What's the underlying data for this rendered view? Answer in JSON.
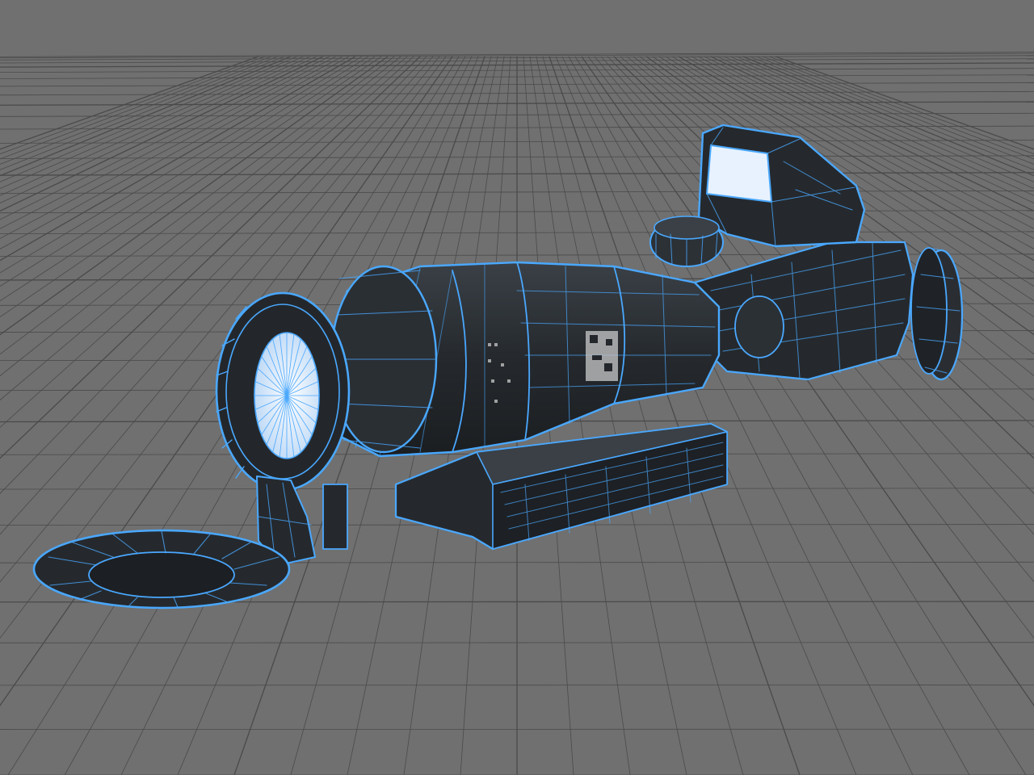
{
  "viewport": {
    "background_color": "#707070",
    "grid_line_color": "#4a4a4a",
    "wire_color": "#4aa8ff",
    "mesh_fill_color": "#23272b",
    "mesh_shade_color": "#2e3338",
    "lens_color": "#cfe6ff",
    "selected_object": "rifle-scope-with-red-dot-mesh"
  }
}
